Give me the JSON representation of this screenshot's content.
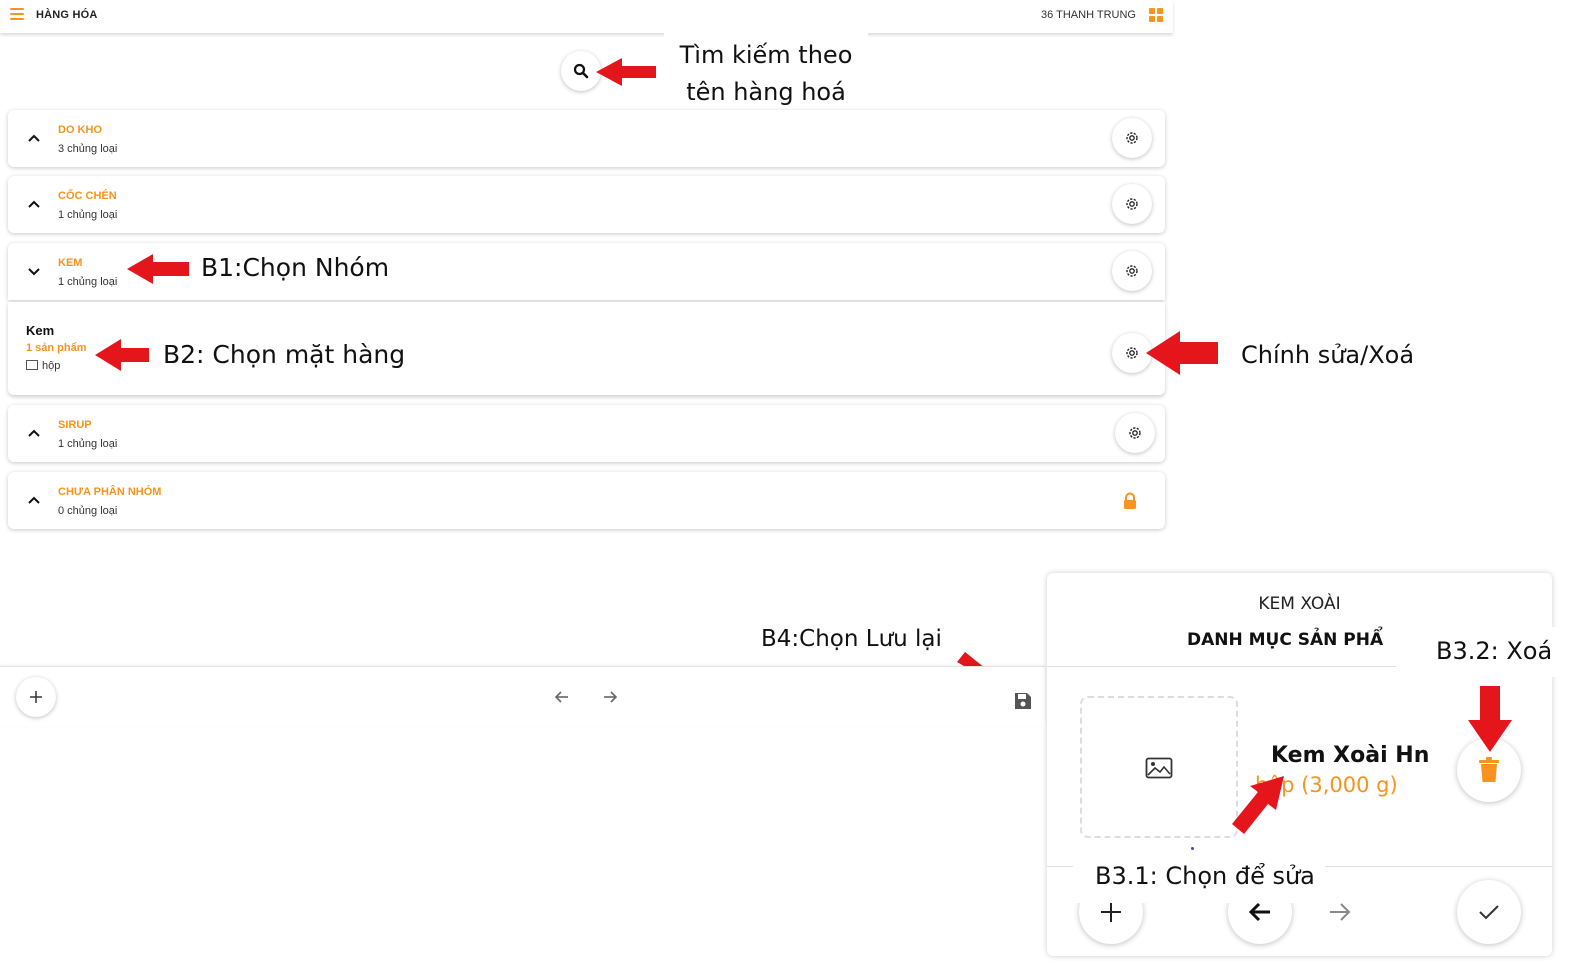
{
  "header": {
    "title": "HÀNG HÓA",
    "user": "36 THANH TRUNG"
  },
  "annotations": {
    "search": [
      "Tìm kiếm theo",
      "tên hàng hoá"
    ],
    "step1": "B1:Chọn Nhóm",
    "step2": "B2: Chọn mặt hàng",
    "edit_delete": "Chính sửa/Xoá",
    "step4": "B4:Chọn Lưu lại",
    "step3_2": "B3.2: Xoá",
    "step3_1": "B3.1: Chọn để sửa"
  },
  "groups": [
    {
      "name": "DO KHO",
      "count": "3 chủng loại"
    },
    {
      "name": "CỐC CHÉN",
      "count": "1 chủng loại"
    },
    {
      "name": "KEM",
      "count": "1 chủng loại"
    },
    {
      "name": "SIRUP",
      "count": "1 chủng loại"
    },
    {
      "name": "CHƯA PHÂN NHÓM",
      "count": "0 chủng loại"
    }
  ],
  "item": {
    "name": "Kem",
    "count": "1 sản phẩm",
    "unit": "hộp"
  },
  "panel": {
    "title": "KEM XOÀI",
    "category": "DANH MỤC SẢN PHẨ",
    "product_name": "Kem Xoài Hn",
    "product_unit": "hộp (3,000 g)"
  },
  "colors": {
    "accent": "#f7931e",
    "arrow": "#e4161c"
  },
  "icons": {
    "menu": "hamburger-icon",
    "apps": "grid-icon",
    "search": "search-icon",
    "gear": "gear-icon",
    "lock": "lock-icon",
    "save": "save-icon",
    "trash": "trash-icon",
    "image": "image-icon"
  }
}
